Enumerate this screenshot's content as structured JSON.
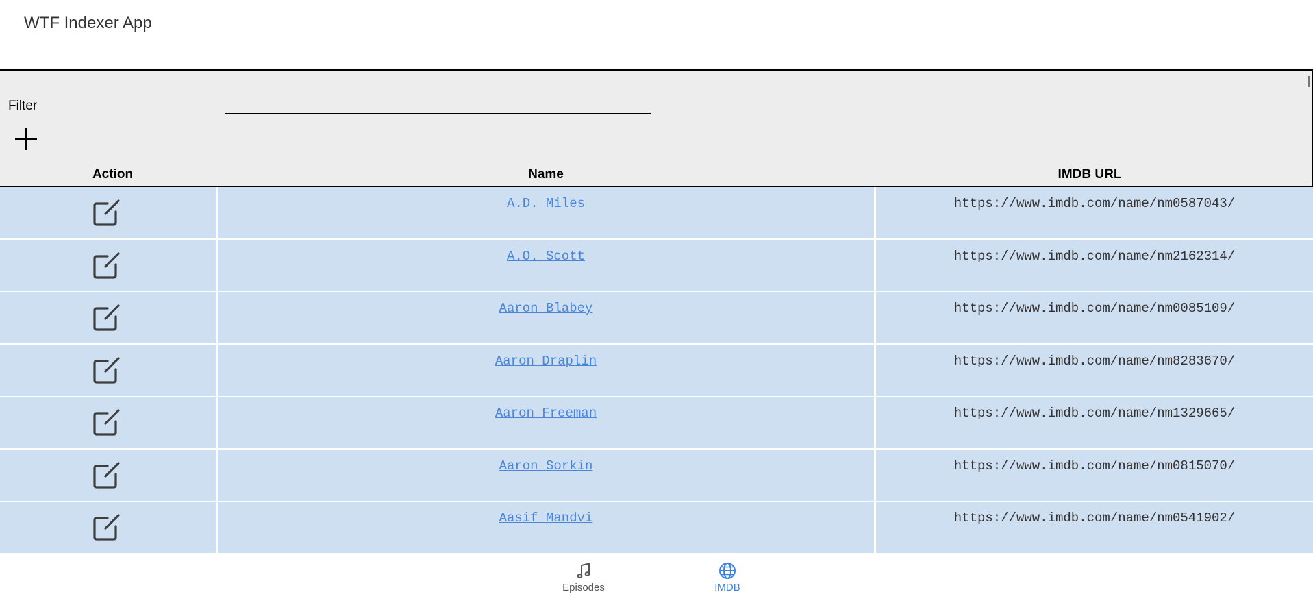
{
  "app": {
    "title": "WTF Indexer App"
  },
  "filter": {
    "label": "Filter",
    "value": "",
    "placeholder": ""
  },
  "toolbar": {
    "add_icon": "plus-icon"
  },
  "table": {
    "columns": [
      "Action",
      "Name",
      "IMDB URL"
    ],
    "rows": [
      {
        "name": "A.D. Miles",
        "url": "https://www.imdb.com/name/nm0587043/"
      },
      {
        "name": "A.O. Scott",
        "url": "https://www.imdb.com/name/nm2162314/"
      },
      {
        "name": "Aaron Blabey",
        "url": "https://www.imdb.com/name/nm0085109/"
      },
      {
        "name": "Aaron Draplin",
        "url": "https://www.imdb.com/name/nm8283670/"
      },
      {
        "name": "Aaron Freeman",
        "url": "https://www.imdb.com/name/nm1329665/"
      },
      {
        "name": "Aaron Sorkin",
        "url": "https://www.imdb.com/name/nm0815070/"
      },
      {
        "name": "Aasif Mandvi",
        "url": "https://www.imdb.com/name/nm0541902/"
      }
    ],
    "row_icon": "edit-icon"
  },
  "nav": {
    "items": [
      {
        "label": "Episodes",
        "icon": "music-note-icon",
        "active": false
      },
      {
        "label": "IMDB",
        "icon": "globe-icon",
        "active": true
      }
    ]
  },
  "colors": {
    "row_bg": "#cfdff2",
    "panel_bg": "#ededed",
    "link": "#4a86d8",
    "active_nav": "#3b82e0",
    "inactive_nav": "#555555"
  }
}
